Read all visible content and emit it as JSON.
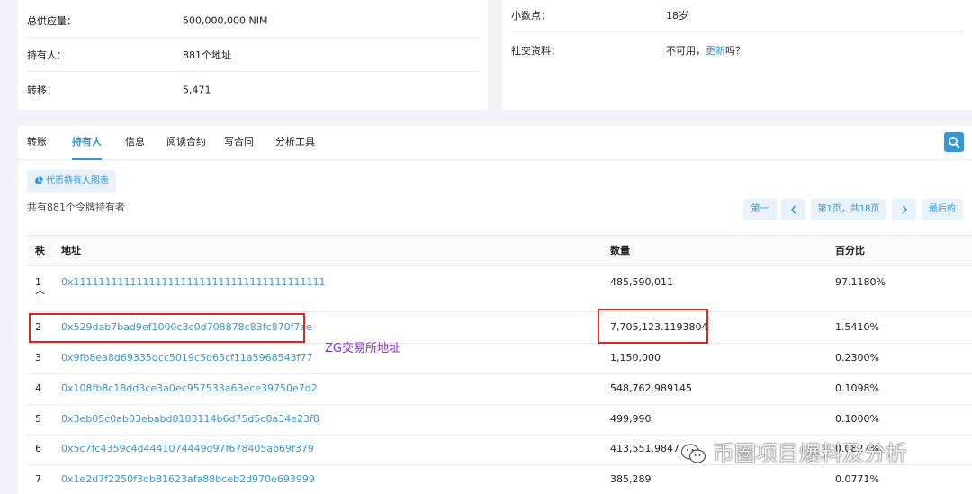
{
  "overview_left": {
    "rows": [
      {
        "label": "总供应量：",
        "value": "500,000,000 NIM"
      },
      {
        "label": "持有人：",
        "value": "881个地址"
      },
      {
        "label": "转移：",
        "value": "5,471"
      }
    ]
  },
  "overview_right": {
    "decimals_label": "小数点：",
    "decimals_value": "18岁",
    "social_label": "社交资料：",
    "social_prefix": "不可用，",
    "social_link": "更新",
    "social_suffix": "吗？"
  },
  "tabs": [
    "转账",
    "持有人",
    "信息",
    "阅读合约",
    "写合同",
    "分析工具"
  ],
  "active_tab": "持有人",
  "chart_button_label": "代币持有人图表",
  "total_holders_text": "共有881个令牌持有者",
  "pagination": {
    "first": "第一",
    "prev_icon": "chevron-left-icon",
    "page_info": "第1页，共18页",
    "next_icon": "chevron-right-icon",
    "last": "最后的"
  },
  "table": {
    "headers": [
      "秩",
      "地址",
      "数量",
      "百分比"
    ],
    "rows": [
      {
        "rank": "1\n个",
        "address": "0x1111111111111111111111111111111111111111",
        "quantity": "485,590,011",
        "percentage": "97.1180%"
      },
      {
        "rank": "2",
        "address": "0x529dab7bad9ef1000c3c0d708878c83fc870f7ae",
        "quantity": "7,705,123.1193804",
        "percentage": "1.5410%"
      },
      {
        "rank": "3",
        "address": "0x9fb8ea8d69335dcc5019c5d65cf11a5968543f77",
        "quantity": "1,150,000",
        "percentage": "0.2300%"
      },
      {
        "rank": "4",
        "address": "0x108fb8c18dd3ce3a0ec957533a63ece39750e7d2",
        "quantity": "548,762.989145",
        "percentage": "0.1098%"
      },
      {
        "rank": "5",
        "address": "0x3eb05c0ab03ebabd0183114b6d75d5c0a34e23f8",
        "quantity": "499,990",
        "percentage": "0.1000%"
      },
      {
        "rank": "6",
        "address": "0x5c7fc4359c4d4441074449d97f678405ab69f379",
        "quantity": "413,551.9847",
        "percentage": "0.0827%"
      },
      {
        "rank": "7",
        "address": "0x1e2d7f2250f3db81623afa88bceb2d970e693999",
        "quantity": "385,289",
        "percentage": "0.0771%"
      }
    ]
  },
  "annotation": "ZG交易所地址",
  "watermark": "币圈项目爆料及分析",
  "colors": {
    "link": "#3498db",
    "highlight": "#e1251b",
    "annotation": "#8a2be2"
  }
}
